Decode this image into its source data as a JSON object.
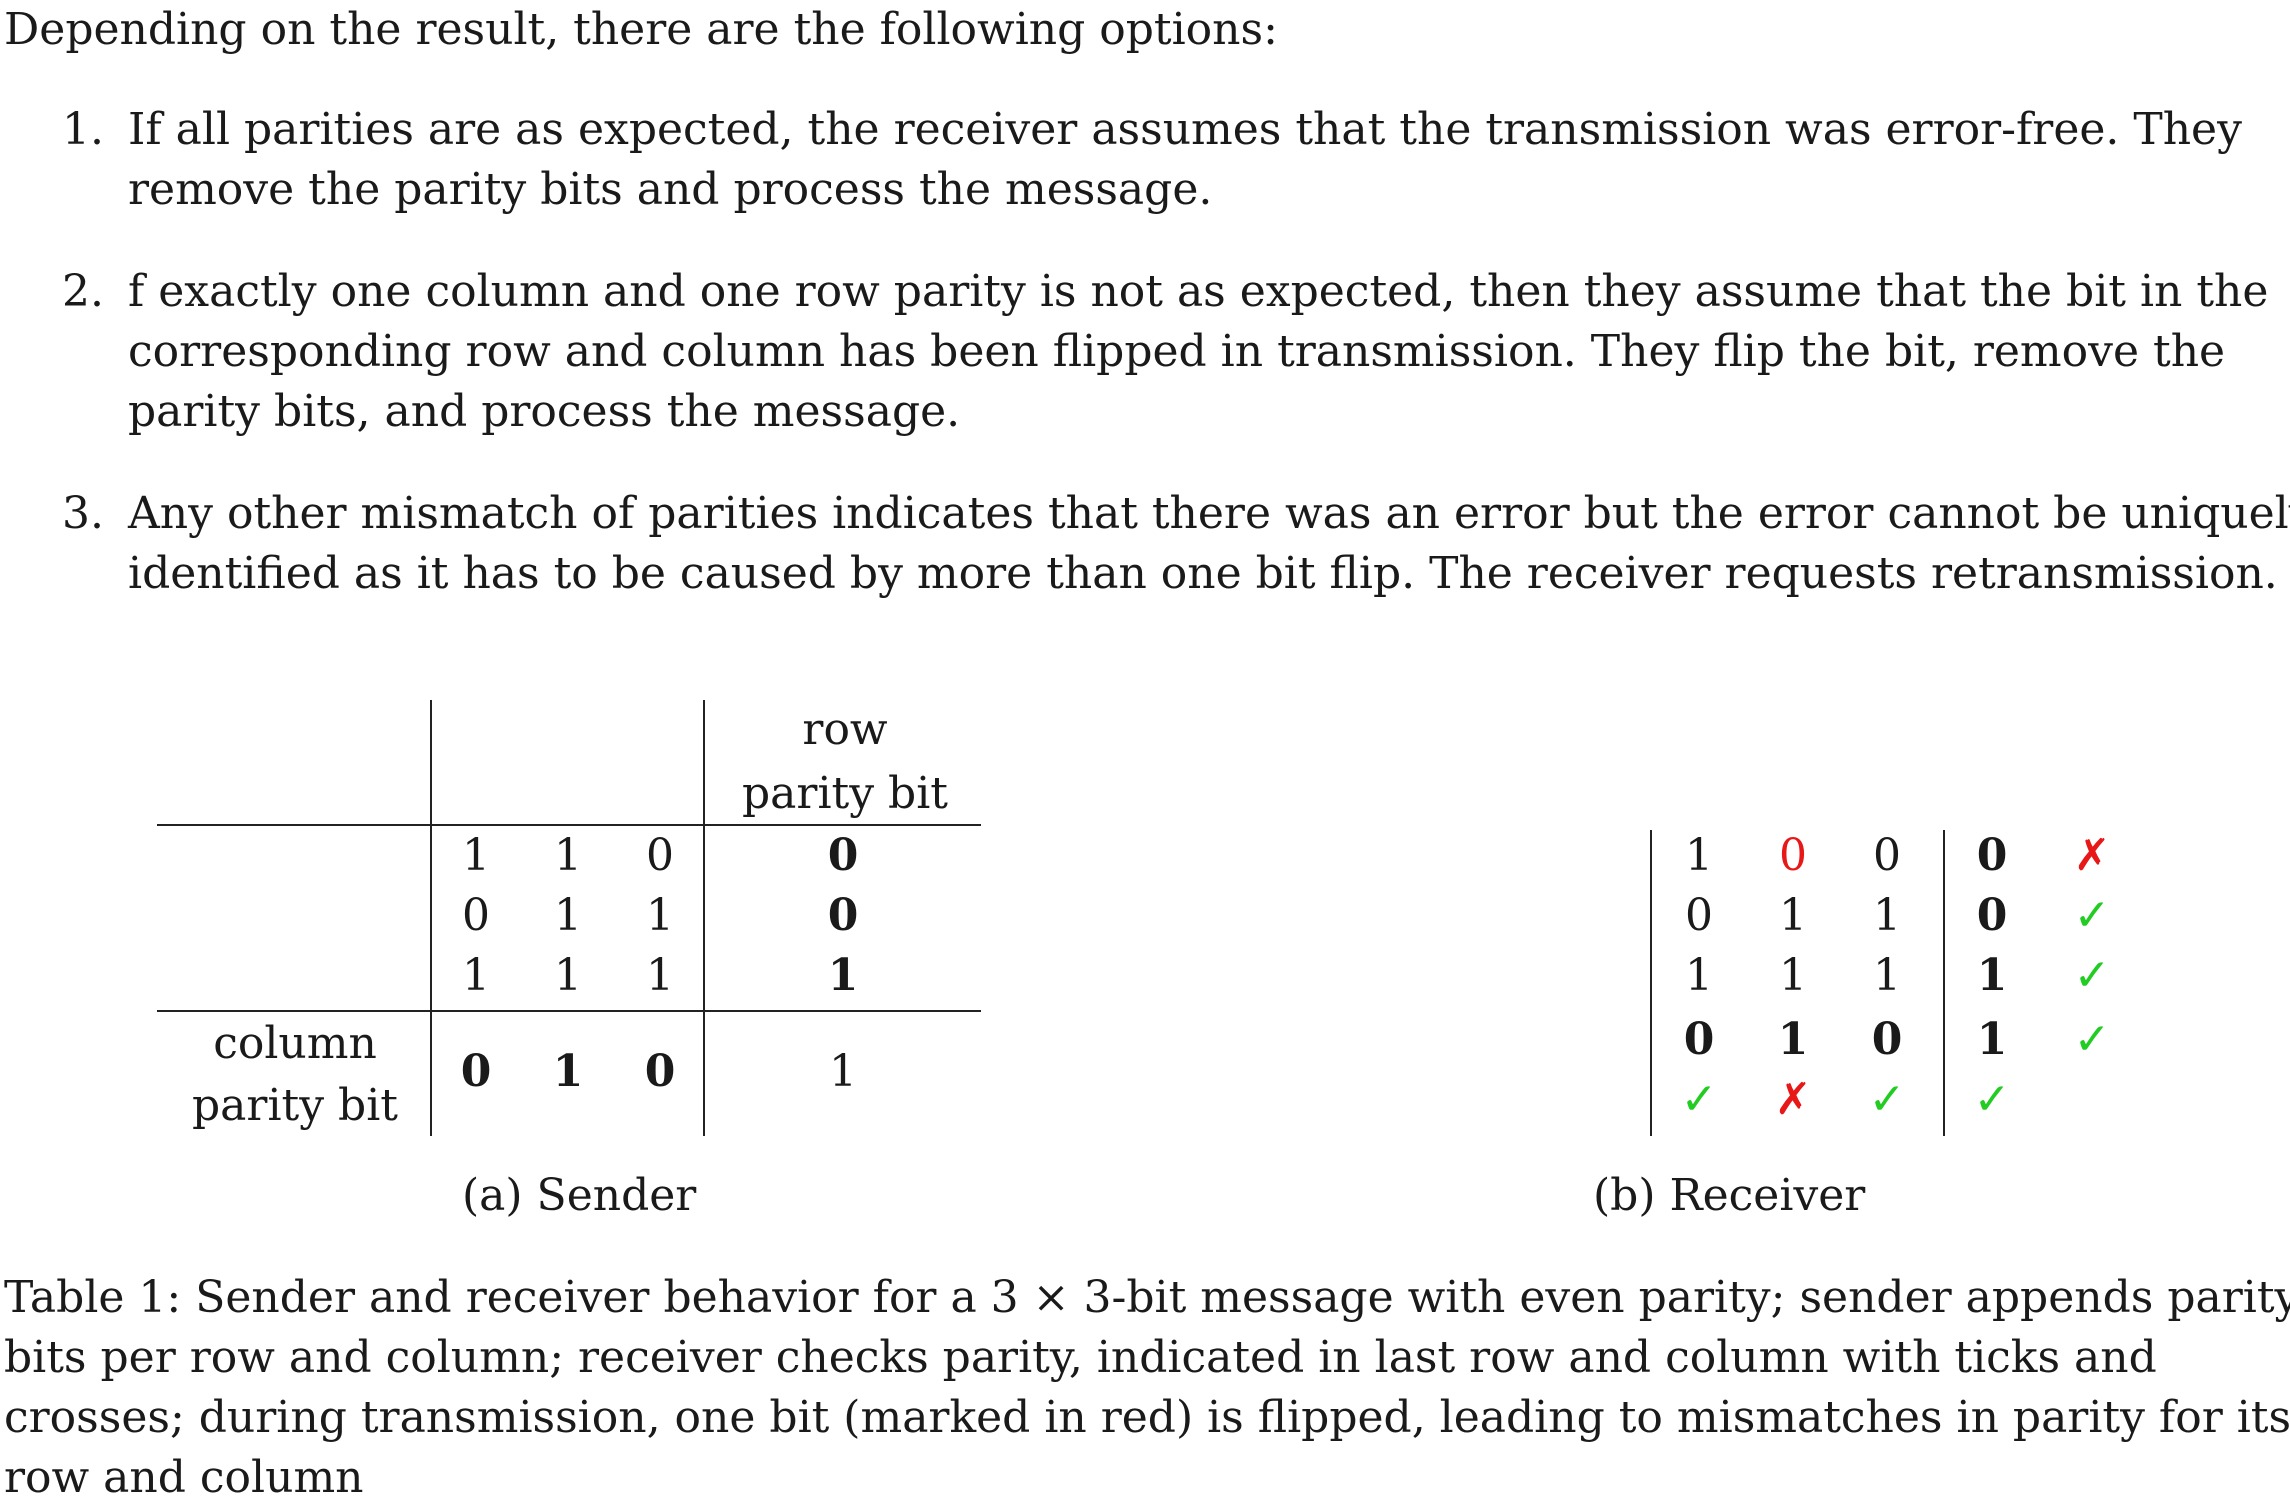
{
  "intro": "Depending on the result, there are the following options:",
  "options": [
    {
      "num": "1.",
      "lines": [
        "If all parities are as expected, the receiver assumes that the transmission was error-free. They",
        "remove the parity bits and process the message."
      ]
    },
    {
      "num": "2.",
      "lines": [
        "f exactly one column and one row parity is not as expected, then they assume that the bit in the",
        "corresponding row and column has been flipped in transmission. They flip the bit, remove the",
        "parity bits, and process the message."
      ]
    },
    {
      "num": "3.",
      "lines": [
        "Any other mismatch of parities indicates that there was an error but the error cannot be uniquely",
        "identified as it has to be caused by more than one bit flip. The receiver requests retransmission."
      ]
    }
  ],
  "sender": {
    "row_parity_header": [
      "row",
      "parity bit"
    ],
    "column_parity_label": [
      "column",
      "parity bit"
    ],
    "bits": [
      [
        "1",
        "1",
        "0"
      ],
      [
        "0",
        "1",
        "1"
      ],
      [
        "1",
        "1",
        "1"
      ]
    ],
    "row_parity": [
      "0",
      "0",
      "1"
    ],
    "column_parity": [
      "0",
      "1",
      "0"
    ],
    "corner": "1",
    "caption": "(a) Sender"
  },
  "receiver": {
    "rows": [
      {
        "bits": [
          "1",
          "0",
          "0"
        ],
        "parity": "0",
        "check": "✗",
        "red_index": 1
      },
      {
        "bits": [
          "0",
          "1",
          "1"
        ],
        "parity": "0",
        "check": "✓"
      },
      {
        "bits": [
          "1",
          "1",
          "1"
        ],
        "parity": "1",
        "check": "✓"
      }
    ],
    "parity_row": {
      "bits": [
        "0",
        "1",
        "0"
      ],
      "parity": "1",
      "check": "✓"
    },
    "column_checks": [
      "✓",
      "✗",
      "✓"
    ],
    "parity_column_check": "✓",
    "caption": "(b) Receiver"
  },
  "table_caption": [
    "Table 1: Sender and receiver behavior for a 3 × 3-bit message with even parity; sender appends parity",
    "bits per row and column; receiver checks parity, indicated in last row and column with ticks and",
    "crosses; during transmission, one bit (marked in red) is flipped, leading to mismatches in parity for its",
    "row and column"
  ],
  "colors": {
    "error": "#e81818",
    "ok": "#22cc22"
  }
}
